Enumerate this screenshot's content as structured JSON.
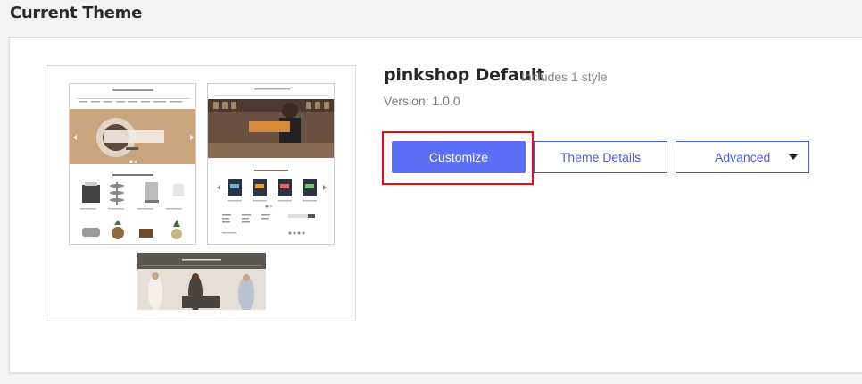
{
  "section": {
    "title": "Current Theme"
  },
  "theme": {
    "name": "pinkshop Default",
    "styles": "Includes 1 style",
    "version": "Version: 1.0.0"
  },
  "buttons": {
    "customize": "Customize",
    "details": "Theme Details",
    "advanced": "Advanced"
  },
  "preview": {
    "banner1": "Books for Cooks",
    "section1": "Most Popular Products",
    "banner2": "Preorder and Explore",
    "section2": "New Products",
    "banner3": "Spring Releases"
  },
  "colors": {
    "accent": "#5b6ef5",
    "outline": "#4b5fe0",
    "highlight": "#e01010"
  }
}
